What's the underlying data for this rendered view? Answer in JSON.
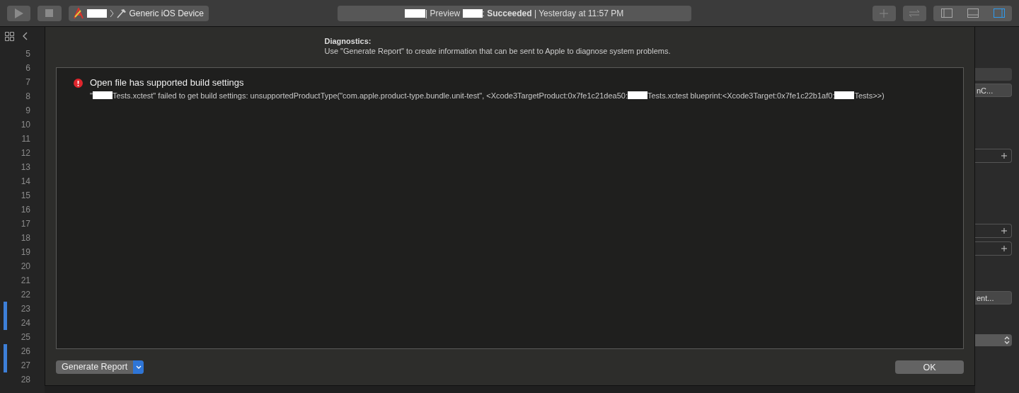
{
  "toolbar": {
    "scheme": {
      "target_parts": [
        {
          "kind": "redacted"
        }
      ],
      "device": "Generic iOS Device"
    },
    "activity": {
      "parts": [
        {
          "kind": "redacted"
        },
        {
          "kind": "text",
          "text": "| Preview "
        },
        {
          "kind": "redacted"
        },
        {
          "kind": "text",
          "text": ": "
        },
        {
          "kind": "bold",
          "text": "Succeeded"
        },
        {
          "kind": "text",
          "text": " | Yesterday at 11:57 PM"
        }
      ]
    },
    "panels": [
      {
        "kind": "navigator",
        "selected": false
      },
      {
        "kind": "debug",
        "selected": false
      },
      {
        "kind": "inspector",
        "selected": true
      }
    ]
  },
  "line_numbers": [
    {
      "number": "5",
      "changed": false
    },
    {
      "number": "6",
      "changed": false
    },
    {
      "number": "7",
      "changed": false
    },
    {
      "number": "8",
      "changed": false
    },
    {
      "number": "9",
      "changed": false
    },
    {
      "number": "10",
      "changed": false
    },
    {
      "number": "11",
      "changed": false
    },
    {
      "number": "12",
      "changed": false
    },
    {
      "number": "13",
      "changed": false
    },
    {
      "number": "14",
      "changed": false
    },
    {
      "number": "15",
      "changed": false
    },
    {
      "number": "16",
      "changed": false
    },
    {
      "number": "17",
      "changed": false
    },
    {
      "number": "18",
      "changed": false
    },
    {
      "number": "19",
      "changed": false
    },
    {
      "number": "20",
      "changed": false
    },
    {
      "number": "21",
      "changed": false
    },
    {
      "number": "22",
      "changed": false
    },
    {
      "number": "23",
      "changed": true
    },
    {
      "number": "24",
      "changed": true
    },
    {
      "number": "25",
      "changed": false
    },
    {
      "number": "26",
      "changed": true
    },
    {
      "number": "27",
      "changed": true
    },
    {
      "number": "28",
      "changed": false
    }
  ],
  "dialog": {
    "title": "Diagnostics:",
    "subtitle": "Use \"Generate Report\" to create information that can be sent to Apple to diagnose system problems.",
    "issues": [
      {
        "title": "Open file has supported build settings",
        "detail": [
          {
            "kind": "text",
            "text": "\""
          },
          {
            "kind": "redacted"
          },
          {
            "kind": "text",
            "text": "Tests.xctest\" failed to get build settings: unsupportedProductType(\"com.apple.product-type.bundle.unit-test\", <Xcode3TargetProduct:0x7fe1c21dea50:"
          },
          {
            "kind": "redacted"
          },
          {
            "kind": "text",
            "text": "Tests.xctest blueprint:<Xcode3Target:0x7fe1c22b1af0:"
          },
          {
            "kind": "redacted"
          },
          {
            "kind": "text",
            "text": "Tests>>)"
          }
        ]
      }
    ],
    "report_button": "Generate Report",
    "ok_button": "OK"
  },
  "inspector": {
    "buttons": [
      "nC...",
      "ent..."
    ]
  }
}
